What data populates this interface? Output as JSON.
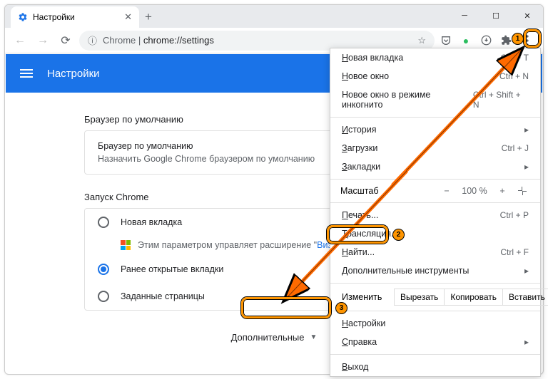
{
  "tab": {
    "title": "Настройки"
  },
  "omnibox": {
    "prefix": "Chrome",
    "url": "chrome://settings"
  },
  "settings_header": "Настройки",
  "sections": {
    "default_browser": {
      "title": "Браузер по умолчанию",
      "card_title": "Браузер по умолчанию",
      "card_sub": "Назначить Google Chrome браузером по умолчанию"
    },
    "startup": {
      "title": "Запуск Chrome",
      "opt1": "Новая вкладка",
      "ext_prefix": "Этим параметром управляет расширение \"",
      "ext_link": "Визуаль",
      "opt2": "Ранее открытые вкладки",
      "opt3": "Заданные страницы"
    }
  },
  "advanced": "Дополнительные",
  "menu": {
    "new_tab": "Новая вкладка",
    "new_tab_sc": "Ctrl + T",
    "new_window": "Новое окно",
    "new_window_sc": "Ctrl + N",
    "incognito": "Новое окно в режиме инкогнито",
    "incognito_sc": "Ctrl + Shift + N",
    "history": "История",
    "downloads": "Загрузки",
    "downloads_sc": "Ctrl + J",
    "bookmarks": "Закладки",
    "zoom": "Масштаб",
    "zoom_val": "100 %",
    "print": "Печать...",
    "print_sc": "Ctrl + P",
    "cast": "Трансляция...",
    "find": "Найти...",
    "find_sc": "Ctrl + F",
    "more_tools": "Дополнительные инструменты",
    "edit": "Изменить",
    "cut": "Вырезать",
    "copy": "Копировать",
    "paste": "Вставить",
    "settings": "Настройки",
    "help": "Справка",
    "exit": "Выход"
  },
  "badges": {
    "b1": "1",
    "b2": "2",
    "b3": "3"
  }
}
